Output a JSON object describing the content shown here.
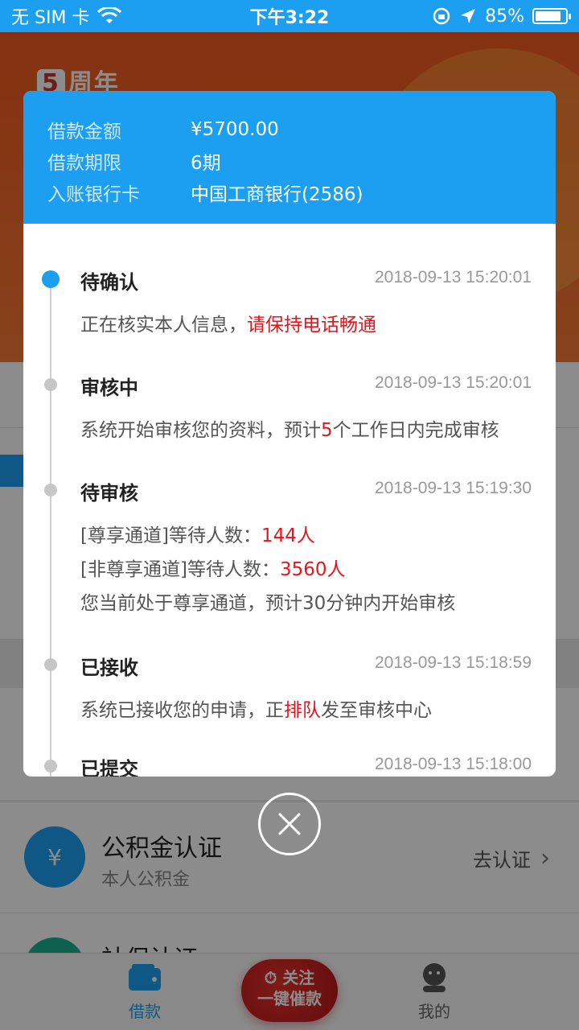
{
  "status_bar": {
    "carrier": "无 SIM 卡",
    "time": "下午3:22",
    "battery": "85%",
    "battery_level": 0.85
  },
  "banner": {
    "logo_number": "5",
    "logo_text": "周年"
  },
  "modal": {
    "info": [
      {
        "label": "借款金额",
        "value": "¥5700.00"
      },
      {
        "label": "借款期限",
        "value": "6期"
      },
      {
        "label": "入账银行卡",
        "value": "中国工商银行(2586)"
      }
    ],
    "timeline": [
      {
        "status": "待确认",
        "time": "2018-09-13 15:20:01",
        "text_before": "正在核实本人信息，",
        "text_red": "请保持电话畅通",
        "text_after": ""
      },
      {
        "status": "审核中",
        "time": "2018-09-13 15:20:01",
        "text_before": "系统开始审核您的资料，预计",
        "text_red": "5",
        "text_after": "个工作日内完成审核"
      },
      {
        "status": "待审核",
        "time": "2018-09-13 15:19:30",
        "line1_before": "[尊享通道]等待人数：",
        "line1_red": "144人",
        "line2_before": "[非尊享通道]等待人数：",
        "line2_red": "3560人",
        "line3": "您当前处于尊享通道，预计30分钟内开始审核"
      },
      {
        "status": "已接收",
        "time": "2018-09-13 15:18:59",
        "text_before": "系统已接收您的申请，正",
        "text_red": "排队",
        "text_after": "发至审核中心"
      },
      {
        "status": "已提交",
        "time": "2018-09-13 15:18:00"
      }
    ]
  },
  "list": {
    "fund": {
      "title": "公积金认证",
      "subtitle": "本人公积金",
      "action": "去认证"
    },
    "social": {
      "title": "社保认证"
    }
  },
  "tab_bar": {
    "loan": "借款",
    "promo_line1": "关注",
    "promo_line2": "一键催款",
    "mine": "我的"
  },
  "colors": {
    "accent": "#1c9ff0",
    "highlight": "#e8141c"
  }
}
